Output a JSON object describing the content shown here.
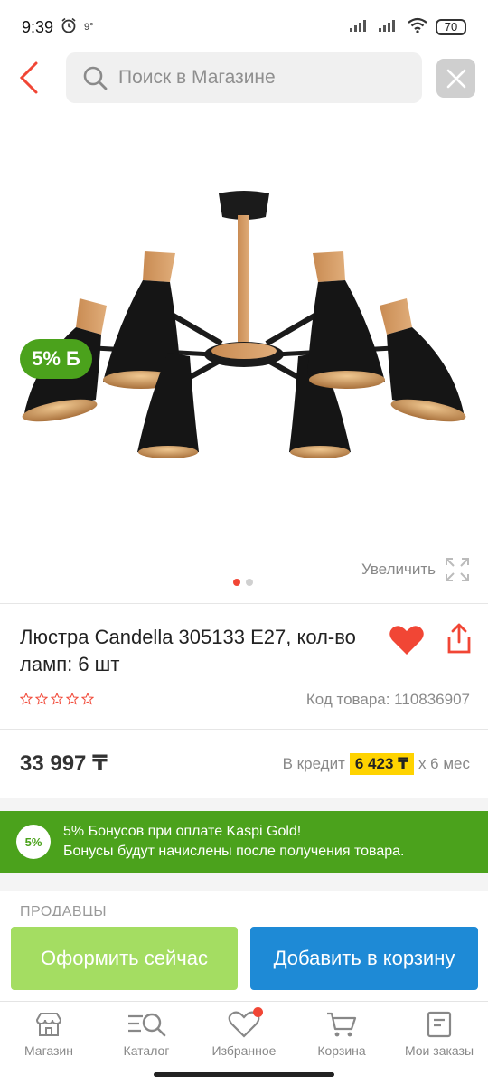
{
  "status_bar": {
    "time": "9:39",
    "temperature": "9°",
    "battery": "70"
  },
  "search": {
    "placeholder": "Поиск в Магазине"
  },
  "product": {
    "bonus_badge": "5% Б",
    "zoom_label": "Увеличить",
    "title": "Люстра Candella 305133 E27, кол-во ламп: 6 шт",
    "sku": "Код товара: 110836907",
    "price": "33 997 ₸",
    "credit_prefix": "В кредит",
    "credit_amount": "6 423 ₸",
    "credit_suffix": "x 6 мес",
    "rating_stars": 0
  },
  "bonus_banner": {
    "circle": "5%",
    "line1": "5% Бонусов при оплате Kaspi Gold!",
    "line2": "Бонусы будут начислены после получения товара."
  },
  "sellers": {
    "title": "ПРОДАВЦЫ"
  },
  "actions": {
    "checkout": "Оформить сейчас",
    "add_to_cart": "Добавить в корзину"
  },
  "tabs": [
    {
      "label": "Магазин",
      "icon": "shop-icon"
    },
    {
      "label": "Каталог",
      "icon": "catalog-search-icon"
    },
    {
      "label": "Избранное",
      "icon": "heart-icon"
    },
    {
      "label": "Корзина",
      "icon": "cart-icon"
    },
    {
      "label": "Мои заказы",
      "icon": "orders-icon"
    }
  ],
  "colors": {
    "accent_red": "#f14635",
    "green": "#4ba21c",
    "blue": "#1e8ad6",
    "light_green": "#a4dd62",
    "yellow": "#ffd300"
  }
}
